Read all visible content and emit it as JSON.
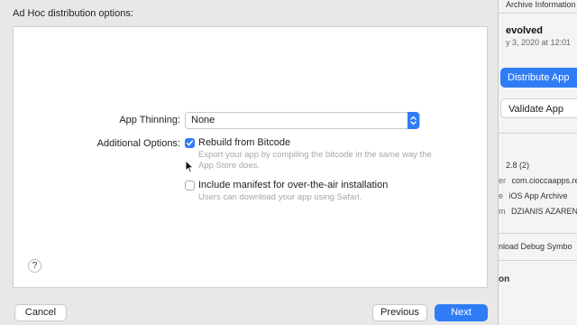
{
  "sheet": {
    "title": "Ad Hoc distribution options:",
    "app_thinning": {
      "label": "App Thinning:",
      "value": "None"
    },
    "additional_options": {
      "label": "Additional Options:",
      "rebuild": {
        "label": "Rebuild from Bitcode",
        "checked": true,
        "description_line1": "Export your app by compiling the bitcode in the same way the",
        "description_line2": "App Store does."
      },
      "manifest": {
        "label": "Include manifest for over-the-air installation",
        "checked": false,
        "description": "Users can download your app using Safari."
      }
    },
    "help_label": "?",
    "buttons": {
      "cancel": "Cancel",
      "previous": "Previous",
      "next": "Next"
    }
  },
  "organizer": {
    "archive_info_title": "Archive Information",
    "app_name": "evolved",
    "date": "y 3, 2020 at 12:01",
    "distribute_button": "Distribute App",
    "validate_button": "Validate App",
    "version": "2.8 (2)",
    "identifier_label": "er",
    "identifier": "com.cioccaapps.re",
    "type_label": "e",
    "type": "iOS App Archive",
    "team_label": "m",
    "team": "DZIANIS AZARENK",
    "debug_symbols": "nload Debug Symbo",
    "section_title": "on"
  },
  "colors": {
    "accent": "#2f7df6",
    "window_bg": "#e8e8e8",
    "panel_bg": "#ffffff",
    "hint_text": "#a6a6a6"
  },
  "icons": {
    "select_stepper": "up-down-chevron-icon",
    "checkmark": "checkmark-icon",
    "cursor": "arrow-cursor-icon"
  }
}
